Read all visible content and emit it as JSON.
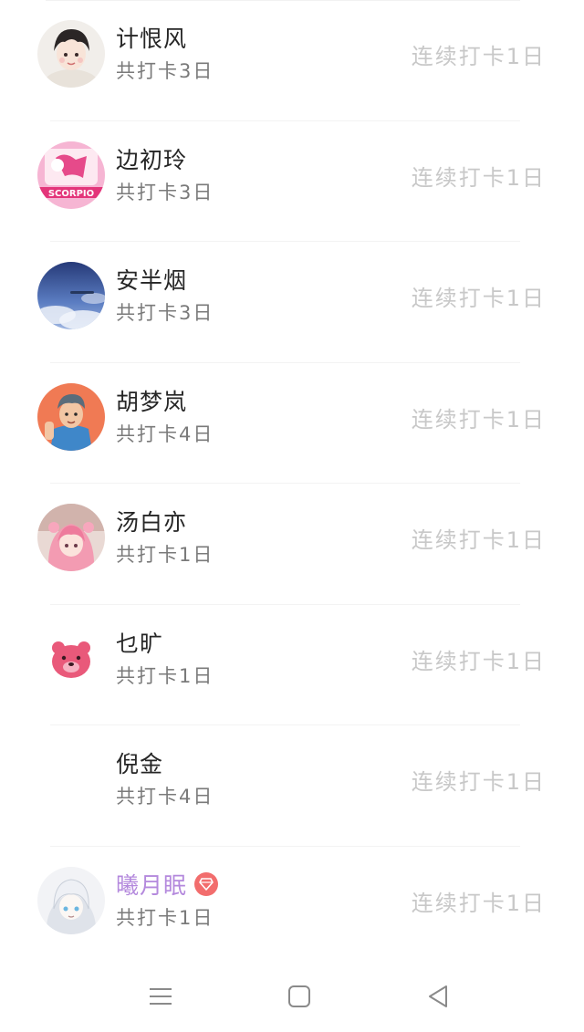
{
  "rows": [
    {
      "name": "计恨风",
      "total": "共打卡3日",
      "streak": "连续打卡1日",
      "avatar": "anime-boy-avatar"
    },
    {
      "name": "边初玲",
      "total": "共打卡3日",
      "streak": "连续打卡1日",
      "avatar": "scorpio-pink-avatar",
      "avatar_text": "SCORPIO"
    },
    {
      "name": "安半烟",
      "total": "共打卡3日",
      "streak": "连续打卡1日",
      "avatar": "blue-sky-avatar"
    },
    {
      "name": "胡梦岚",
      "total": "共打卡4日",
      "streak": "连续打卡1日",
      "avatar": "cartoon-man-avatar"
    },
    {
      "name": "汤白亦",
      "total": "共打卡1日",
      "streak": "连续打卡1日",
      "avatar": "pink-hair-girl-avatar"
    },
    {
      "name": "乜旷",
      "total": "共打卡1日",
      "streak": "连续打卡1日",
      "avatar": "pink-bear-avatar"
    },
    {
      "name": "倪金",
      "total": "共打卡4日",
      "streak": "连续打卡1日",
      "avatar": "blank-avatar"
    },
    {
      "name": "曦月眠",
      "total": "共打卡1日",
      "streak": "连续打卡1日",
      "avatar": "white-hair-avatar",
      "vip": true
    }
  ],
  "colors": {
    "name": "#262626",
    "vip_name": "#b489dd",
    "total": "#7a7a7a",
    "streak": "#c8c8c8",
    "vip_badge": "#f26d6d"
  },
  "navbar": {
    "icons": [
      "menu-icon",
      "home-square-icon",
      "back-triangle-icon"
    ]
  }
}
